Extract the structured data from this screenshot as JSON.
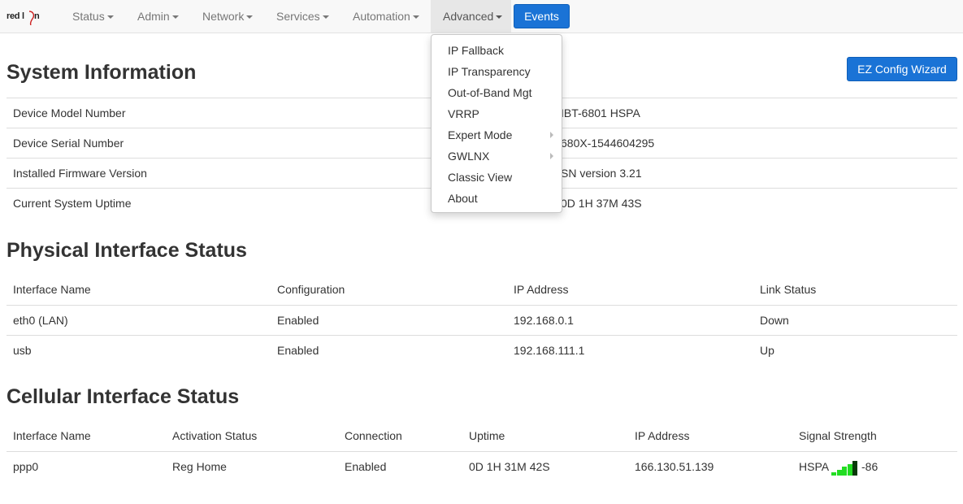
{
  "brand": {
    "logo_text": "red lion"
  },
  "nav": {
    "items": [
      {
        "label": "Status"
      },
      {
        "label": "Admin"
      },
      {
        "label": "Network"
      },
      {
        "label": "Services"
      },
      {
        "label": "Automation"
      },
      {
        "label": "Advanced"
      }
    ],
    "events_label": "Events"
  },
  "dropdown": {
    "items": [
      {
        "label": "IP Fallback"
      },
      {
        "label": "IP Transparency"
      },
      {
        "label": "Out-of-Band Mgt"
      },
      {
        "label": "VRRP"
      },
      {
        "label": "Expert Mode"
      },
      {
        "label": "GWLNX"
      },
      {
        "label": "Classic View"
      },
      {
        "label": "About"
      }
    ]
  },
  "system_info": {
    "title": "System Information",
    "ez_wizard_label": "EZ Config Wizard",
    "rows": [
      {
        "label": "Device Model Number",
        "value": "IBT-6801 HSPA"
      },
      {
        "label": "Device Serial Number",
        "value": "680X-1544604295"
      },
      {
        "label": "Installed Firmware Version",
        "value": "SN version 3.21"
      },
      {
        "label": "Current System Uptime",
        "value": "0D 1H 37M 43S"
      }
    ]
  },
  "physical": {
    "title": "Physical Interface Status",
    "headers": [
      "Interface Name",
      "Configuration",
      "IP Address",
      "Link Status"
    ],
    "rows": [
      [
        "eth0 (LAN)",
        "Enabled",
        "192.168.0.1",
        "Down"
      ],
      [
        "usb",
        "Enabled",
        "192.168.111.1",
        "Up"
      ]
    ]
  },
  "cellular": {
    "title": "Cellular Interface Status",
    "headers": [
      "Interface Name",
      "Activation Status",
      "Connection",
      "Uptime",
      "IP Address",
      "Signal Strength"
    ],
    "rows": [
      {
        "interface": "ppp0",
        "activation": "Reg Home",
        "connection": "Enabled",
        "uptime": "0D 1H 31M 42S",
        "ip": "166.130.51.139",
        "signal_type": "HSPA",
        "signal_value": "-86",
        "signal_bars_lit": 4,
        "signal_bars_total": 5
      }
    ]
  },
  "colors": {
    "primary_button": "#1a73d6",
    "signal_lit": "#22dd22",
    "signal_strong": "#0a3a0a"
  }
}
